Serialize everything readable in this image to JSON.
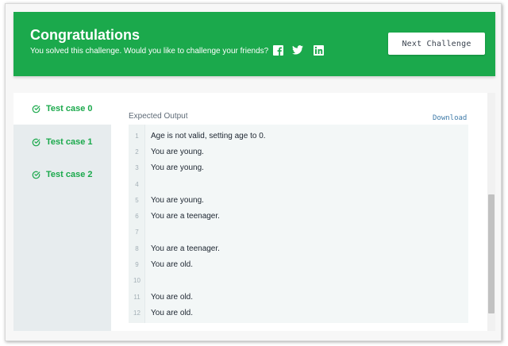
{
  "banner": {
    "title": "Congratulations",
    "subtitle": "You solved this challenge. Would you like to challenge your friends?",
    "social_icons": [
      "facebook-icon",
      "twitter-icon",
      "linkedin-icon"
    ],
    "next_button_label": "Next Challenge",
    "color": "#1ba94c"
  },
  "tabs": [
    {
      "label": "Test case 0",
      "active": true
    },
    {
      "label": "Test case 1",
      "active": false
    },
    {
      "label": "Test case 2",
      "active": false
    }
  ],
  "output": {
    "label": "Expected Output",
    "download_label": "Download",
    "lines": [
      {
        "n": "1",
        "text": "Age is not valid, setting age to 0."
      },
      {
        "n": "2",
        "text": "You are young."
      },
      {
        "n": "3",
        "text": "You are young."
      },
      {
        "n": "4",
        "text": ""
      },
      {
        "n": "5",
        "text": "You are young."
      },
      {
        "n": "6",
        "text": "You are a teenager."
      },
      {
        "n": "7",
        "text": ""
      },
      {
        "n": "8",
        "text": "You are a teenager."
      },
      {
        "n": "9",
        "text": "You are old."
      },
      {
        "n": "10",
        "text": ""
      },
      {
        "n": "11",
        "text": "You are old."
      },
      {
        "n": "12",
        "text": "You are old."
      }
    ]
  }
}
